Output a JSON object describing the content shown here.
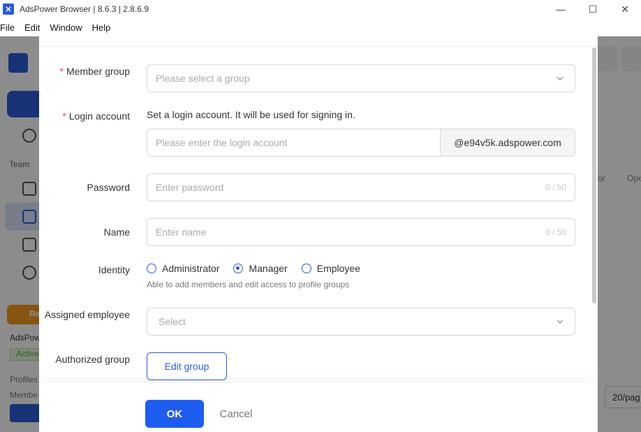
{
  "window": {
    "title": "AdsPower Browser | 8.6.3 | 2.8.6.9",
    "minimize": "—",
    "maximize": "☐",
    "close": "✕"
  },
  "menu": [
    "File",
    "Edit",
    "Window",
    "Help"
  ],
  "background": {
    "team_label": "Team",
    "promo_label": "Re",
    "account_label": "AdsPow",
    "status_badge": "Active",
    "profiles_label": "Profiles",
    "members_label": "Membe",
    "col_op_label": "Ope",
    "col_or_label": "or",
    "pager_label": "20/pag"
  },
  "form": {
    "member_group": {
      "label": "Member group",
      "placeholder": "Please select a group",
      "required": true
    },
    "login_account": {
      "label": "Login account",
      "hint": "Set a login account. It will be used for signing in.",
      "placeholder": "Please enter the login account",
      "suffix": "@e94v5k.adspower.com",
      "required": true
    },
    "password": {
      "label": "Password",
      "placeholder": "Enter password",
      "counter": "0 / 50"
    },
    "name": {
      "label": "Name",
      "placeholder": "Enter name",
      "counter": "0 / 50"
    },
    "identity": {
      "label": "Identity",
      "options": [
        "Administrator",
        "Manager",
        "Employee"
      ],
      "selected": "Manager",
      "hint": "Able to add members and edit access to profile groups"
    },
    "assigned_employee": {
      "label": "Assigned employee",
      "placeholder": "Select"
    },
    "authorized_group": {
      "label": "Authorized group",
      "button": "Edit group"
    }
  },
  "footer": {
    "ok": "OK",
    "cancel": "Cancel"
  },
  "colors": {
    "primary": "#1f5cf0",
    "required": "#e54545"
  }
}
